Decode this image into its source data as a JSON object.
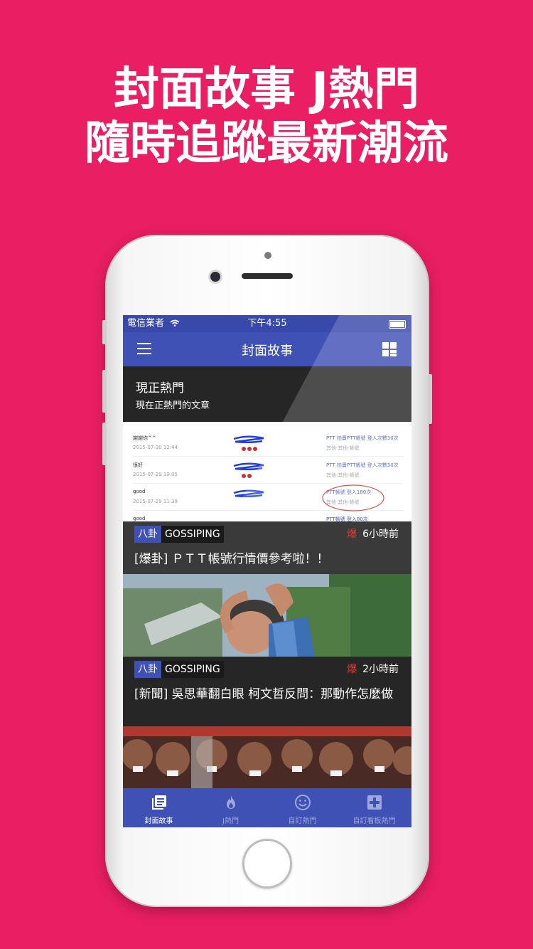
{
  "headline": {
    "line1": "封面故事 J熱門",
    "line2": "隨時追蹤最新潮流"
  },
  "status_bar": {
    "carrier": "電信業者",
    "time": "下午4:55"
  },
  "nav": {
    "title": "封面故事",
    "menu_icon": "hamburger-menu-icon",
    "layout_icon": "grid-layout-icon"
  },
  "section": {
    "title": "現正熱門",
    "subtitle": "現在正熱門的文章"
  },
  "preview_rows": [
    {
      "name": "謝謝你^^",
      "date": "2015-07-30 12:44",
      "link": "PTT 拍賣PTT帳號 登入次數30次",
      "meta": "其他·其他·帳號"
    },
    {
      "name": "很好",
      "date": "2015-07-29 19:05",
      "link": "PTT 拍賣PTT帳號 登入次數30次",
      "meta": "其他·其他·帳號"
    },
    {
      "name": "good",
      "date": "2015-07-29 11:39",
      "link": "PTT帳號 登入180次",
      "meta": "其他·其他·帳號"
    },
    {
      "name": "good",
      "date": "",
      "link": "PTT帳號 登入80次",
      "meta": ""
    }
  ],
  "cards": [
    {
      "tag_cn": "八卦",
      "tag_en": "GOSSIPING",
      "time": "6小時前",
      "title": "[爆卦] ＰＴＴ帳號行情價參考啦！！",
      "hot_label": "爆"
    },
    {
      "tag_cn": "八卦",
      "tag_en": "GOSSIPING",
      "time": "2小時前",
      "title": "[新聞] 吳思華翻白眼 柯文哲反問：那動作怎麼做",
      "hot_label": "爆"
    }
  ],
  "tabs": [
    {
      "label": "封面故事",
      "icon": "news-icon",
      "active": true
    },
    {
      "label": "J熱門",
      "icon": "flame-icon",
      "active": false
    },
    {
      "label": "自訂熱門",
      "icon": "smiley-icon",
      "active": false
    },
    {
      "label": "自訂看板熱門",
      "icon": "board-add-icon",
      "active": false
    }
  ],
  "colors": {
    "background": "#e91e63",
    "primary": "#3f51b5",
    "primary_dark": "#3949ab",
    "hot": "#e53935"
  }
}
